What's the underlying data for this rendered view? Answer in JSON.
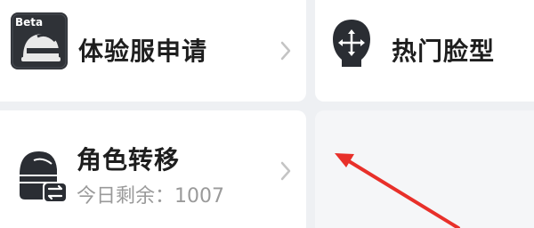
{
  "cards": {
    "beta": {
      "title": "体验服申请",
      "badge": "Beta",
      "icon": "beta-helmet-icon",
      "chevron": "chevron-right-icon"
    },
    "face": {
      "title": "热门脸型",
      "icon": "face-move-icon"
    },
    "role": {
      "title": "角色转移",
      "subtitle": "今日剩余：1007",
      "icon": "helmet-transfer-icon",
      "chevron": "chevron-right-icon"
    }
  },
  "annotation": {
    "icon": "red-arrow-icon",
    "color": "#e8302a"
  },
  "colors": {
    "background": "#eef0f3",
    "card": "#ffffff",
    "title": "#1e1e1e",
    "subtitle": "#9a9a9a",
    "chevron": "#c4c4c4",
    "icon_dark": "#2a2d33"
  }
}
